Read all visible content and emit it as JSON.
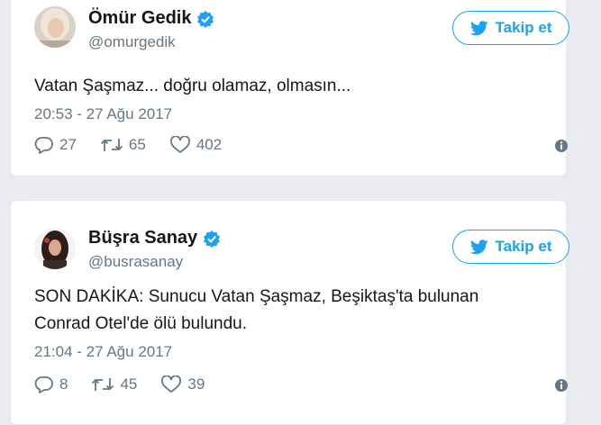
{
  "tweets": [
    {
      "name": "Ömür Gedik",
      "handle": "@omurgedik",
      "follow_label": "Takip et",
      "text": "Vatan Şaşmaz... doğru olamaz, olmasın...",
      "time": "20:53 - 27 Ağu 2017",
      "replies": "27",
      "retweets": "65",
      "likes": "402"
    },
    {
      "name": "Büşra Sanay",
      "handle": "@busrasanay",
      "follow_label": "Takip et",
      "text_line1": "SON DAKİKA: Sunucu Vatan Şaşmaz, Beşiktaş'ta bulunan",
      "text_line2": "Conrad Otel'de ölü bulundu.",
      "time": "21:04 - 27 Ağu 2017",
      "replies": "8",
      "retweets": "45",
      "likes": "39"
    }
  ],
  "colors": {
    "accent": "#1da1f2",
    "muted": "#657786",
    "text": "#14171a"
  },
  "icons": [
    "verified-icon",
    "twitter-bird-icon",
    "reply-icon",
    "retweet-icon",
    "like-icon",
    "info-icon"
  ]
}
